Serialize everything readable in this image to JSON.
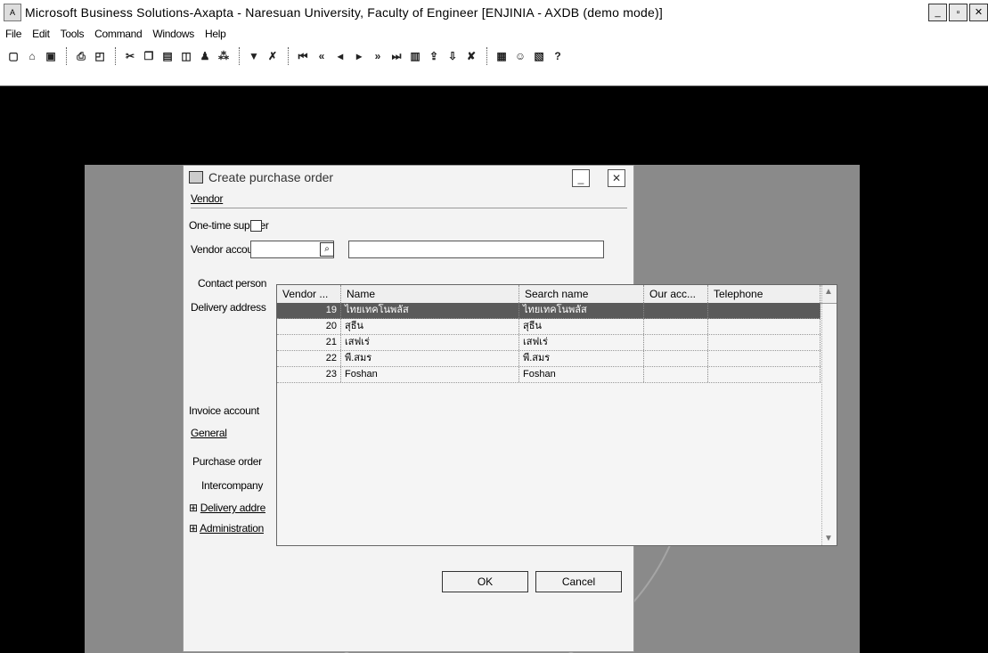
{
  "window": {
    "title": "Microsoft Business Solutions-Axapta - Naresuan University, Faculty of Engineer [ENJINIA - AXDB (demo mode)]",
    "icon": "axapta-app-icon"
  },
  "menu": [
    "File",
    "Edit",
    "Tools",
    "Command",
    "Windows",
    "Help"
  ],
  "toolbar": {
    "icons": [
      "new-icon",
      "open-icon",
      "save-icon",
      "print-icon",
      "print-preview-icon",
      "cut-icon",
      "copy-icon",
      "paste-icon",
      "chart-icon",
      "find-icon",
      "find-next-icon",
      "filter-icon",
      "remove-filter-icon",
      "first-record-icon",
      "previous-page-icon",
      "previous-record-icon",
      "next-record-icon",
      "next-page-icon",
      "last-record-icon",
      "document-icon",
      "export-icon",
      "import-icon",
      "delete-icon",
      "report-icon",
      "users-icon",
      "properties-icon",
      "help-icon"
    ]
  },
  "dialog": {
    "title": "Create purchase order",
    "vendor_group": "Vendor",
    "one_time_supplier": "One-time supplier",
    "vendor_account": "Vendor account",
    "contact_person": "Contact person",
    "delivery_address": "Delivery address",
    "invoice_account": "Invoice account",
    "general_group": "General",
    "purchase_order": "Purchase order",
    "intercompany": "Intercompany",
    "delivery_address_group": "Delivery addre",
    "administration_group": "Administration",
    "ok": "OK",
    "cancel": "Cancel"
  },
  "lookup": {
    "columns": [
      "Vendor ...",
      "Name",
      "Search name",
      "Our acc...",
      "Telephone"
    ],
    "rows": [
      {
        "vendor": "19",
        "name": "ไทยเทคโนพลัส",
        "search": "ไทยเทคโนพลัส",
        "our": "",
        "tel": "",
        "selected": true
      },
      {
        "vendor": "20",
        "name": "สุธีน",
        "search": "สุธีน",
        "our": "",
        "tel": "",
        "selected": false
      },
      {
        "vendor": "21",
        "name": "เสฟเร่",
        "search": "เสฟเร่",
        "our": "",
        "tel": "",
        "selected": false
      },
      {
        "vendor": "22",
        "name": "พี.สมร",
        "search": "พี.สมร",
        "our": "",
        "tel": "",
        "selected": false
      },
      {
        "vendor": "23",
        "name": "Foshan",
        "search": "Foshan",
        "our": "",
        "tel": "",
        "selected": false
      }
    ]
  }
}
